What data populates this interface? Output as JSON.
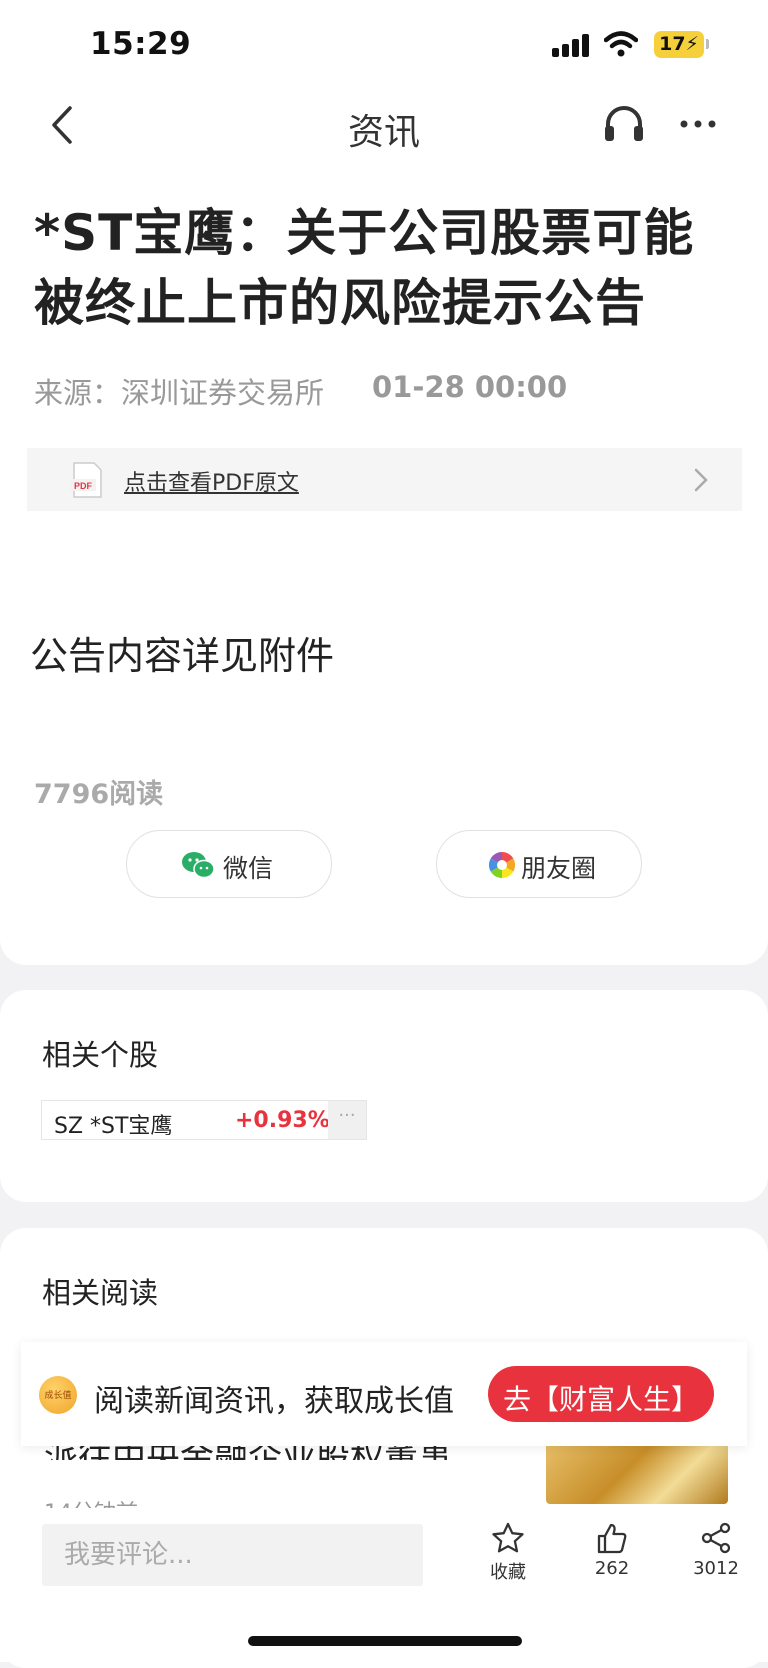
{
  "status_bar": {
    "time": "15:29",
    "battery": "17"
  },
  "nav": {
    "title": "资讯"
  },
  "article": {
    "title": "*ST宝鹰：关于公司股票可能被终止上市的风险提示公告",
    "source": "来源：深圳证券交易所",
    "time": "01-28 00:00",
    "pdf_link": "点击查看PDF原文",
    "content": "公告内容详见附件",
    "read_count": "7796阅读"
  },
  "share": {
    "wechat": "微信",
    "moments": "朋友圈"
  },
  "related_stocks": {
    "title": "相关个股",
    "items": [
      {
        "name": "SZ *ST宝鹰",
        "change": "+0.93%",
        "more": "···"
      }
    ]
  },
  "related_reading": {
    "title": "相关阅读",
    "items": [
      {
        "headline": "派往中央金融企业股权董事…",
        "time": "14分钟前"
      }
    ]
  },
  "growth_banner": {
    "badge": "成长值",
    "text": "阅读新闻资讯，获取成长值",
    "button": "去【财富人生】"
  },
  "bottom_bar": {
    "comment_placeholder": "我要评论...",
    "favorite_label": "收藏",
    "like_count": "262",
    "share_count": "3012"
  },
  "colors": {
    "accent_red": "#e8333e",
    "wechat_green": "#2aae67"
  }
}
